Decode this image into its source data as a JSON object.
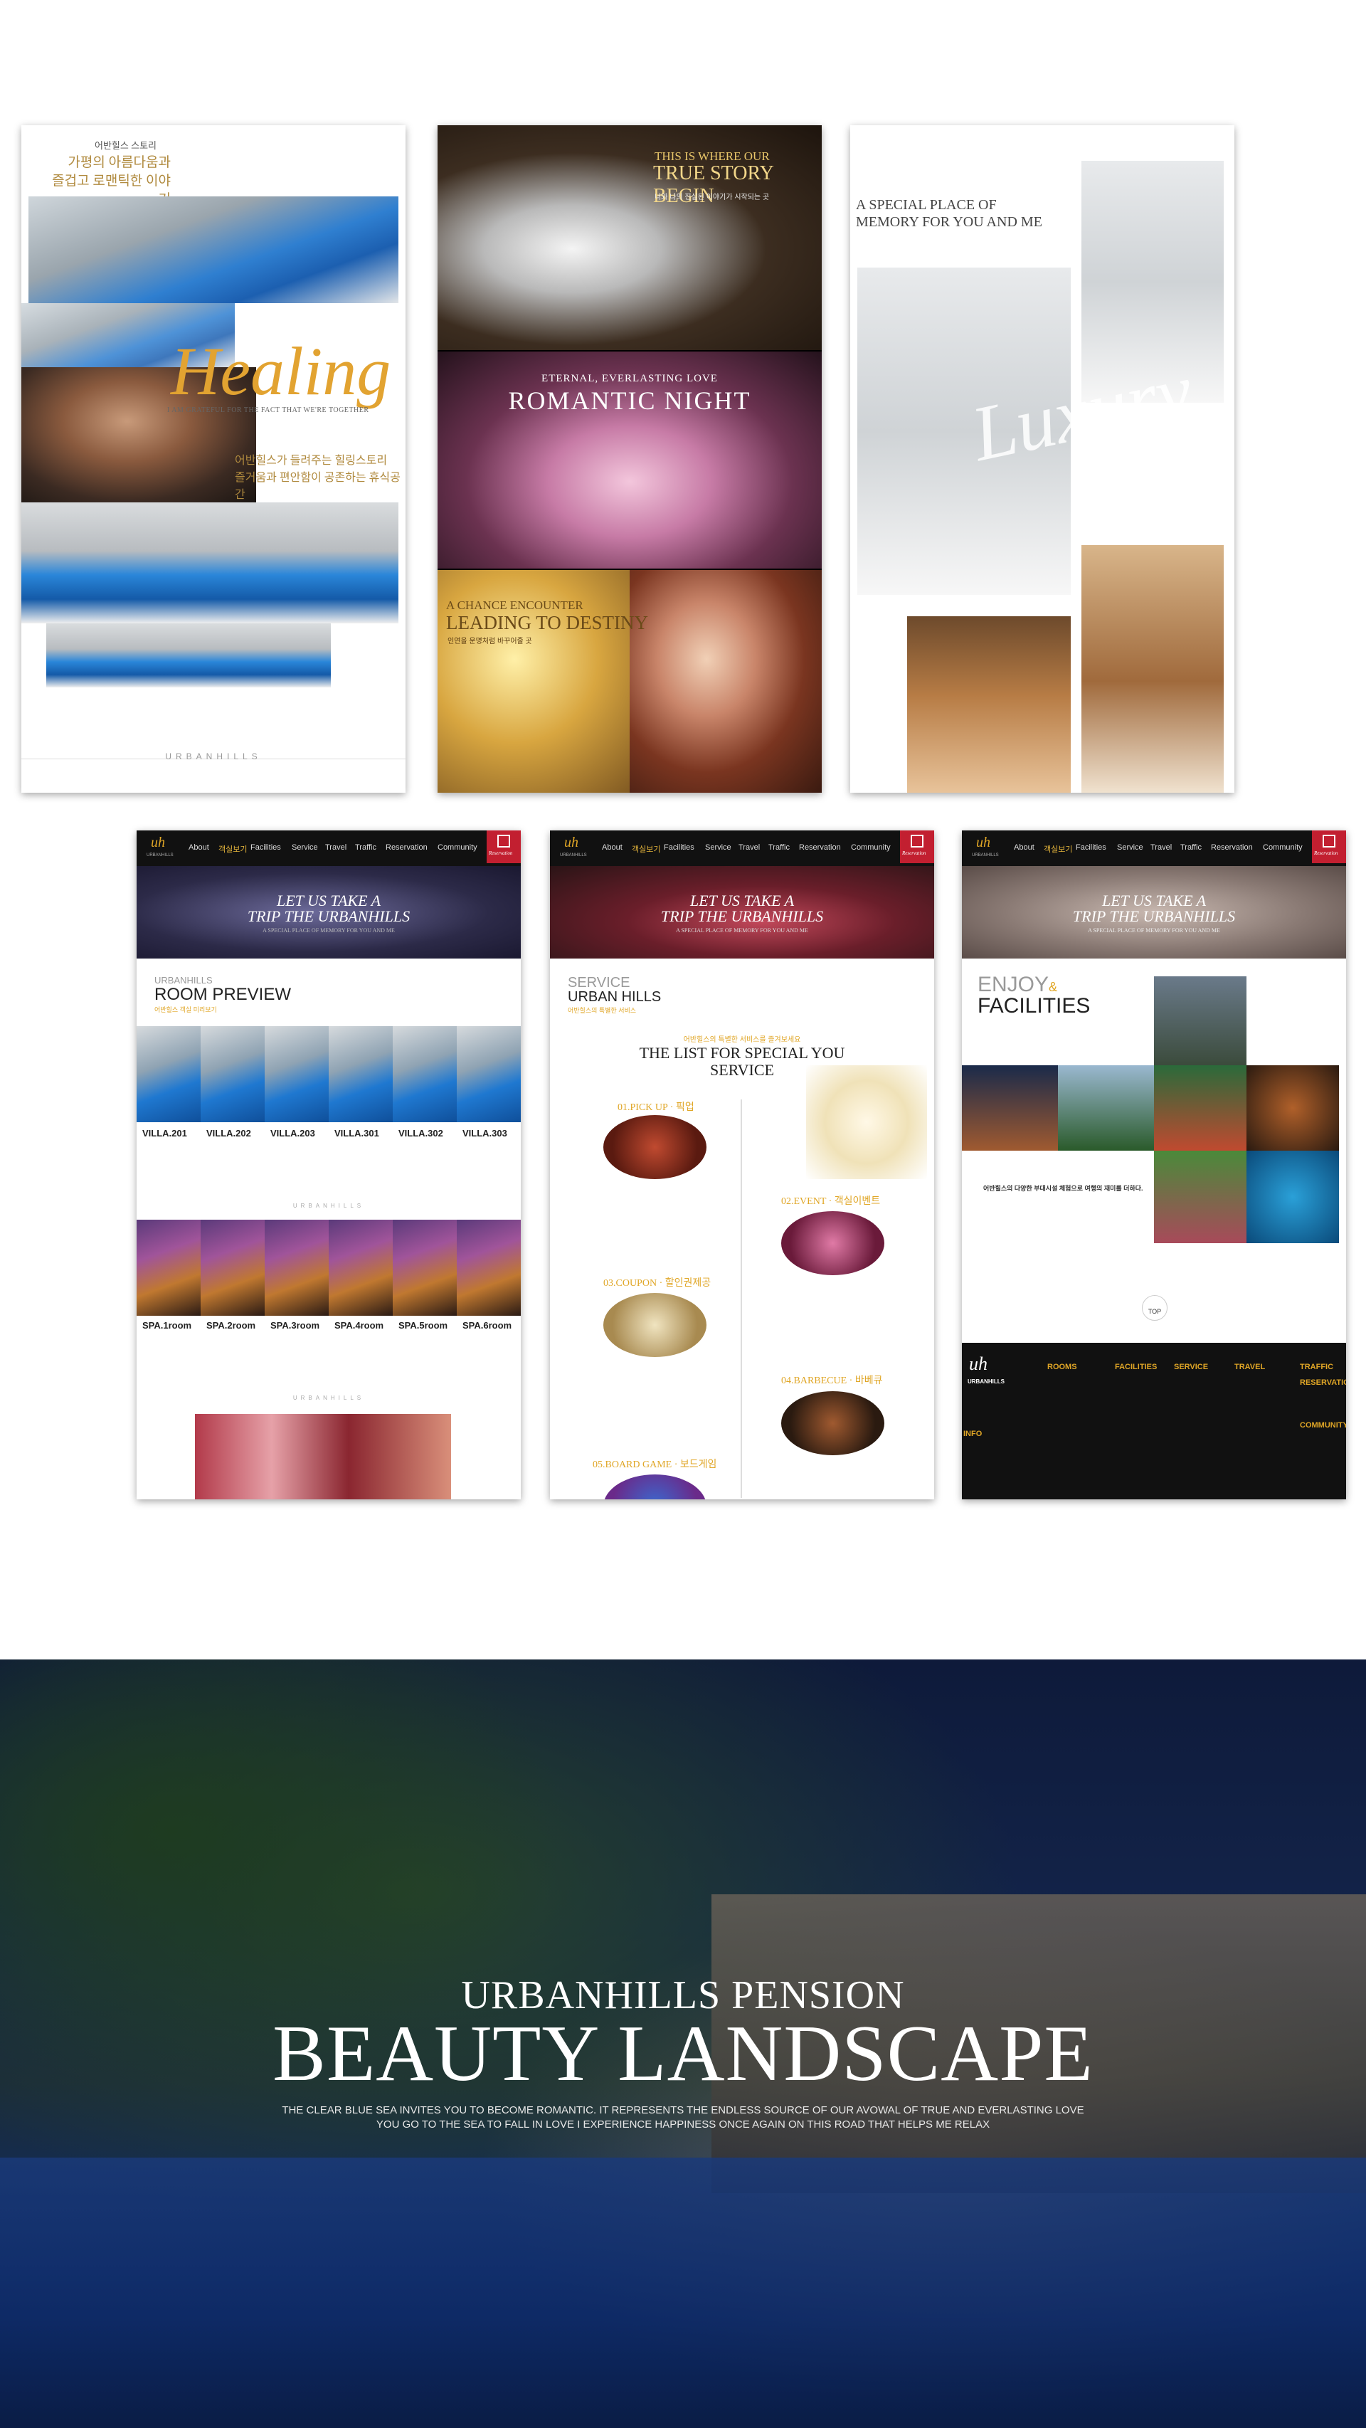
{
  "poster_healing": {
    "kr_small": "어반힐스 스토리",
    "kr_title_1": "가평의 아름다움과",
    "kr_title_2": "즐겁고 로맨틱한 이야기",
    "script": "Healing",
    "caption": "I AM GRATEFUL FOR THE FACT THAT WE'RE TOGETHER",
    "kr_sub_1": "어반힐스가 들려주는 힐링스토리",
    "kr_sub_2": "즐거움과 편안함이 공존하는 휴식공간",
    "brand": "URBANHILLS"
  },
  "poster_story": {
    "top_small": "THIS IS WHERE OUR",
    "top_big": "TRUE STORY BEGIN",
    "top_kr": "너와 나의 진실된 이야기가 시작되는 곳",
    "mid_small": "ETERNAL, EVERLASTING LOVE",
    "mid_big": "ROMANTIC NIGHT",
    "bot_small": "A CHANCE ENCOUNTER",
    "bot_big": "LEADING TO DESTINY",
    "bot_kr": "인연을 운명처럼 바꾸어줄 곳"
  },
  "poster_luxury": {
    "title_1": "A SPECIAL PLACE OF",
    "title_2": "MEMORY FOR YOU AND ME",
    "script": "Luxury"
  },
  "web_common": {
    "logo": "uh",
    "logo_sub": "URBANHILLS",
    "nav": [
      "About",
      "객실보기",
      "Facilities",
      "Service",
      "Travel",
      "Traffic",
      "Reservation",
      "Community"
    ],
    "resv_label": "Reservation",
    "hero_1": "LET US TAKE A",
    "hero_2": "TRIP THE URBANHILLS",
    "hero_3": "A SPECIAL PLACE OF MEMORY FOR YOU AND ME"
  },
  "page_rooms": {
    "section_small": "URBANHILLS",
    "section_big": "ROOM PREVIEW",
    "section_kr": "어반힐스 객실 미리보기",
    "villas": [
      "VILLA.201",
      "VILLA.202",
      "VILLA.203",
      "VILLA.301",
      "VILLA.302",
      "VILLA.303"
    ],
    "spas": [
      "SPA.1room",
      "SPA.2room",
      "SPA.3room",
      "SPA.4room",
      "SPA.5room",
      "SPA.6room"
    ],
    "divider": "URBANHILLS"
  },
  "page_service": {
    "section_small": "SERVICE",
    "section_big": "URBAN HILLS",
    "section_kr": "어반힐스의 특별한 서비스",
    "tag_kr": "어반힐스의 특별한 서비스를 즐겨보세요",
    "list_1": "THE LIST FOR SPECIAL YOU",
    "list_2": "SERVICE",
    "items": [
      "01.PICK UP · 픽업",
      "02.EVENT · 객실이벤트",
      "03.COUPON · 할인권제공",
      "04.BARBECUE · 바베큐",
      "05.BOARD GAME · 보드게임"
    ]
  },
  "page_facilities": {
    "title_1": "ENJOY",
    "title_amp": "&",
    "title_2": "FACILITIES",
    "kr": "어반힐스의 다양한 부대시설 체험으로 여행의 재미를 더하다.",
    "top": "TOP",
    "footer_logo": "URBANHILLS",
    "footer_cols": [
      "ROOMS",
      "FACILITIES",
      "SERVICE",
      "TRAVEL",
      "TRAFFIC",
      "RESERVATION",
      "COMMUNITY"
    ],
    "info": "INFO"
  },
  "banner": {
    "line_1": "URBANHILLS PENSION",
    "line_2": "BEAUTY LANDSCAPE",
    "desc_1": "THE CLEAR BLUE SEA INVITES YOU TO BECOME ROMANTIC. IT REPRESENTS THE ENDLESS SOURCE OF OUR AVOWAL OF TRUE AND EVERLASTING LOVE",
    "desc_2": "YOU GO TO THE SEA TO FALL IN LOVE I EXPERIENCE HAPPINESS ONCE AGAIN ON THIS ROAD THAT HELPS ME RELAX"
  }
}
